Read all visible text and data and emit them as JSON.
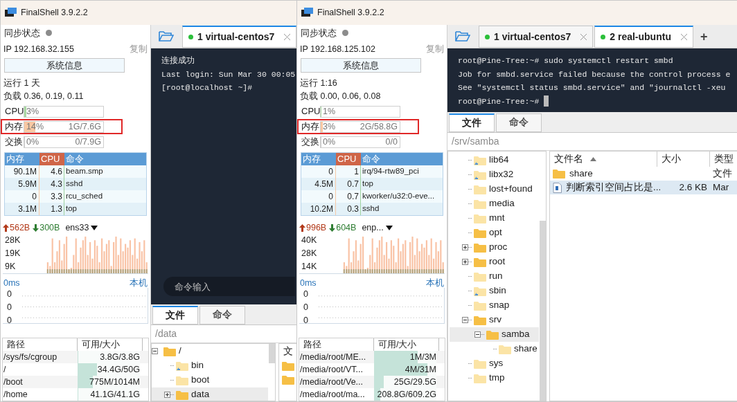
{
  "windows": [
    {
      "title": "FinalShell 3.9.2.2",
      "sidebar": {
        "sync_label": "同步状态",
        "ip": "IP 192.168.32.155",
        "copy": "复制",
        "sysinfo_button": "系统信息",
        "uptime": "运行 1 天",
        "load": "负载 0.36, 0.19, 0.11",
        "meters": [
          {
            "kind": "cpu",
            "label": "CPU",
            "percent": "3%",
            "level": 0.03,
            "highlighted": false
          },
          {
            "kind": "memory",
            "label": "内存",
            "percent": "14%",
            "amount": "1G/7.6G",
            "level": 0.14,
            "highlighted": true
          },
          {
            "kind": "swap",
            "label": "交换",
            "percent": "0%",
            "amount": "0/7.9G",
            "level": 0,
            "highlighted": false
          }
        ],
        "process_columns": [
          {
            "label": "内存",
            "sorted": false
          },
          {
            "label": "CPU",
            "sorted": true
          },
          {
            "label": "命令",
            "sorted": false
          }
        ],
        "processes": [
          [
            "90.1M",
            "4.6",
            "beam.smp"
          ],
          [
            "5.9M",
            "4.3",
            "sshd"
          ],
          [
            "0",
            "3.3",
            "rcu_sched"
          ],
          [
            "3.1M",
            "1.3",
            "top"
          ]
        ],
        "network": {
          "up": "562B",
          "down": "300B",
          "interface": "ens33",
          "y_labels": [
            "28K",
            "19K",
            "9K"
          ]
        },
        "ping": {
          "label": "0ms",
          "host": "本机",
          "values": [
            "0",
            "0",
            "0"
          ]
        },
        "disk_columns": [
          "路径",
          "可用/大小"
        ],
        "disks": [
          {
            "path": "/sys/fs/cgroup",
            "size": "3.8G/3.8G",
            "level": 0
          },
          {
            "path": "/",
            "size": "34.4G/50G",
            "level": 0.31
          },
          {
            "path": "/boot",
            "size": "775M/1014M",
            "level": 0.24
          },
          {
            "path": "/home",
            "size": "41.1G/41.1G",
            "level": 0
          }
        ]
      },
      "tabs": [
        {
          "label": "1 virtual-centos7",
          "connected": true,
          "selected": true
        }
      ],
      "terminal": {
        "lines": [
          "连接成功",
          "Last login: Sun Mar 30 00:05",
          "[root@localhost ~]#"
        ],
        "cursor": false,
        "command_input": {
          "placeholder": "命令输入"
        }
      },
      "bottom_tabs": [
        {
          "label": "文件",
          "selected": true
        },
        {
          "label": "命令",
          "selected": false
        }
      ],
      "path": "/data",
      "tree": [
        {
          "name": "/",
          "kind": "folder",
          "expanded": true,
          "selected": false,
          "children": [
            {
              "name": "bin",
              "kind": "link",
              "selected": false
            },
            {
              "name": "boot",
              "kind": "folder-pale",
              "selected": false
            },
            {
              "name": "data",
              "kind": "folder",
              "expanded": false,
              "selected": true
            }
          ]
        }
      ],
      "files": {
        "columns": [
          {
            "label": "文"
          }
        ],
        "rows": [
          {
            "kind": "folder",
            "selected": false
          },
          {
            "kind": "folder",
            "selected": false
          }
        ]
      }
    },
    {
      "title": "FinalShell 3.9.2.2",
      "sidebar": {
        "sync_label": "同步状态",
        "ip": "IP 192.168.125.102",
        "copy": "复制",
        "sysinfo_button": "系统信息",
        "uptime": "运行 1:16",
        "load": "负载 0.00, 0.06, 0.08",
        "meters": [
          {
            "kind": "cpu",
            "label": "CPU",
            "percent": "1%",
            "level": 0.01,
            "highlighted": false
          },
          {
            "kind": "memory",
            "label": "内存",
            "percent": "3%",
            "amount": "2G/58.8G",
            "level": 0.03,
            "highlighted": true
          },
          {
            "kind": "swap",
            "label": "交换",
            "percent": "0%",
            "amount": "0/0",
            "level": 0,
            "highlighted": false
          }
        ],
        "process_columns": [
          {
            "label": "内存",
            "sorted": false
          },
          {
            "label": "CPU",
            "sorted": true
          },
          {
            "label": "命令",
            "sorted": false
          }
        ],
        "processes": [
          [
            "0",
            "1",
            "irq/94-rtw89_pci"
          ],
          [
            "4.5M",
            "0.7",
            "top"
          ],
          [
            "0",
            "0.7",
            "kworker/u32:0-eve..."
          ],
          [
            "10.2M",
            "0.3",
            "sshd"
          ]
        ],
        "network": {
          "up": "996B",
          "down": "604B",
          "interface": "enp...",
          "y_labels": [
            "40K",
            "28K",
            "14K"
          ]
        },
        "ping": {
          "label": "0ms",
          "host": "本机",
          "values": [
            "0",
            "0",
            "0"
          ]
        },
        "disk_columns": [
          "路径",
          "可用/大小"
        ],
        "disks": [
          {
            "path": "/media/root/ME...",
            "size": "1M/3M",
            "level": 0.7
          },
          {
            "path": "/media/root/VT...",
            "size": "4M/31M",
            "level": 0.85
          },
          {
            "path": "/media/root/Ve...",
            "size": "25G/29.5G",
            "level": 0.15
          },
          {
            "path": "/media/root/ma...",
            "size": "208.8G/609.2G",
            "level": 0.1
          }
        ]
      },
      "tabs": [
        {
          "label": "1 virtual-centos7",
          "connected": true,
          "selected": false
        },
        {
          "label": "2 real-ubuntu",
          "connected": true,
          "selected": true
        }
      ],
      "new_tab": "+",
      "terminal": {
        "lines": [
          "root@Pine-Tree:~# sudo systemctl restart smbd",
          "Job for smbd.service failed because the control process e",
          "See \"systemctl status smbd.service\" and \"journalctl -xeu",
          "root@Pine-Tree:~#"
        ],
        "cursor": true
      },
      "bottom_tabs": [
        {
          "label": "文件",
          "selected": true
        },
        {
          "label": "命令",
          "selected": false
        }
      ],
      "path": "/srv/samba",
      "tree": [
        {
          "name": "lib64",
          "kind": "link",
          "selected": false
        },
        {
          "name": "libx32",
          "kind": "link",
          "selected": false
        },
        {
          "name": "lost+found",
          "kind": "folder-pale",
          "selected": false
        },
        {
          "name": "media",
          "kind": "folder-pale",
          "selected": false
        },
        {
          "name": "mnt",
          "kind": "folder-pale",
          "selected": false
        },
        {
          "name": "opt",
          "kind": "folder",
          "selected": false
        },
        {
          "name": "proc",
          "kind": "folder",
          "expanded": false,
          "selected": false
        },
        {
          "name": "root",
          "kind": "folder",
          "expanded": false,
          "selected": false
        },
        {
          "name": "run",
          "kind": "folder-pale",
          "selected": false
        },
        {
          "name": "sbin",
          "kind": "link",
          "selected": false
        },
        {
          "name": "snap",
          "kind": "folder-pale",
          "selected": false
        },
        {
          "name": "srv",
          "kind": "folder",
          "expanded": true,
          "selected": false,
          "children": [
            {
              "name": "samba",
              "kind": "folder",
              "expanded": true,
              "selected": true,
              "children": [
                {
                  "name": "share",
                  "kind": "folder-pale",
                  "selected": false
                }
              ]
            }
          ]
        },
        {
          "name": "sys",
          "kind": "folder-pale",
          "selected": false
        },
        {
          "name": "tmp",
          "kind": "folder-pale",
          "selected": false
        }
      ],
      "files": {
        "columns": [
          {
            "label": "文件名",
            "sorted": true
          },
          {
            "label": "大小"
          },
          {
            "label": "类型"
          }
        ],
        "rows": [
          {
            "kind": "folder",
            "name": "share",
            "type": "文件",
            "selected": false
          },
          {
            "kind": "file",
            "name": "判断索引空间占比是...",
            "size": "2.6 KB",
            "type": "Mar",
            "selected": true
          }
        ]
      }
    }
  ]
}
